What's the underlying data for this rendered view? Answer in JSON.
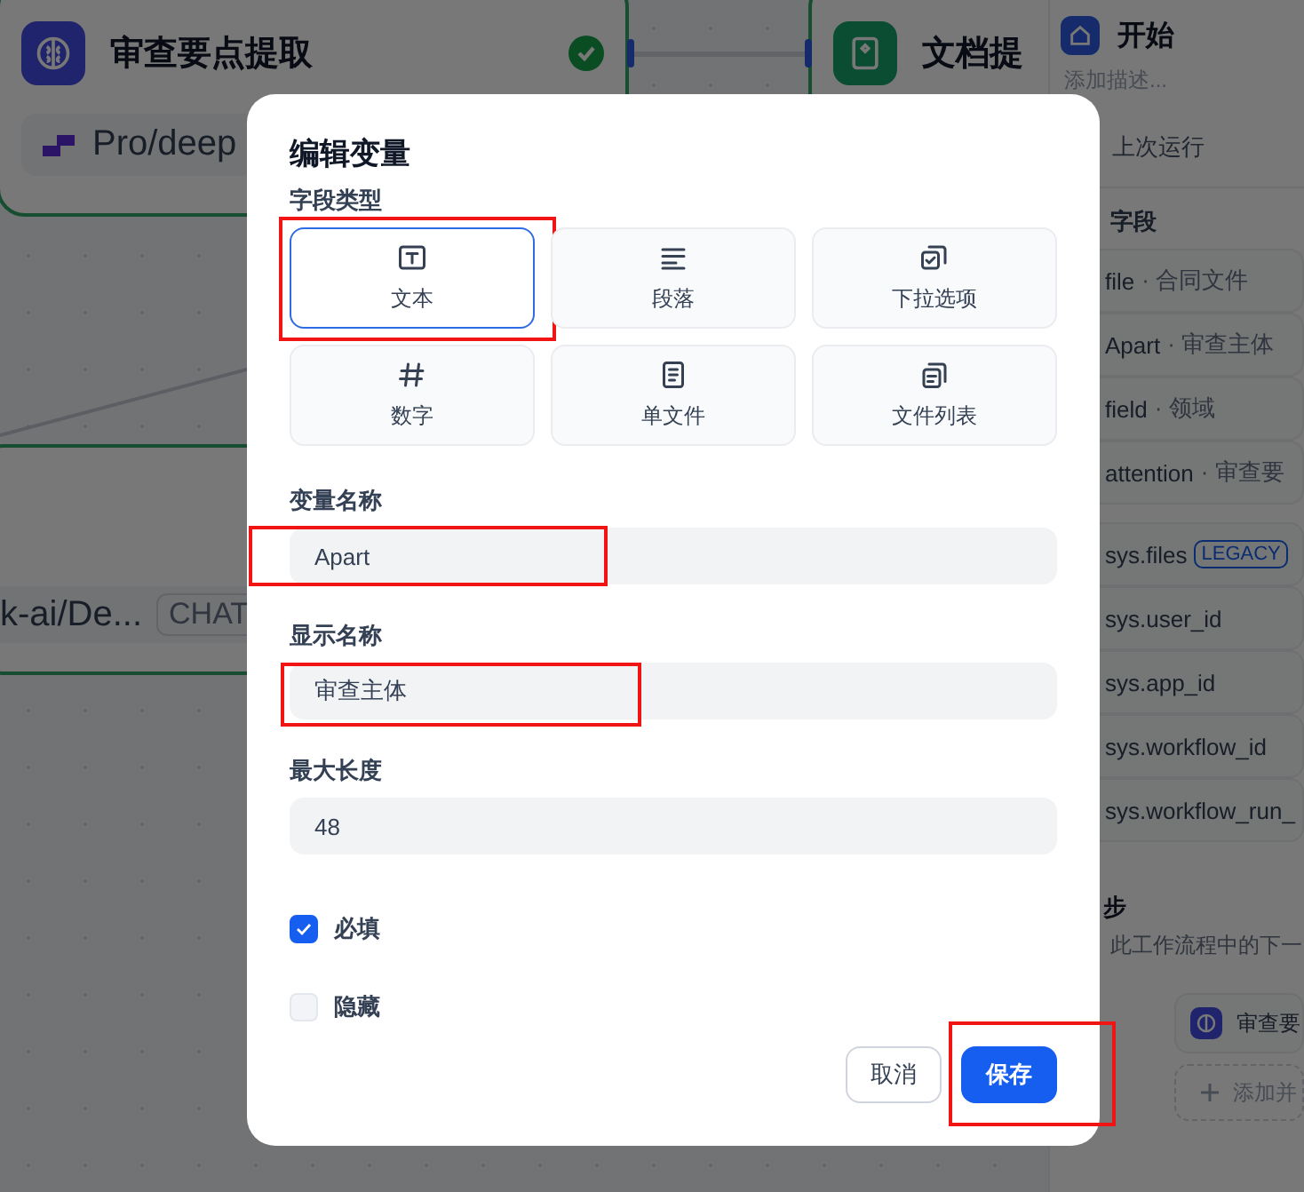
{
  "canvas": {
    "nodes": [
      {
        "title": "审查要点提取",
        "kind": "llm",
        "done": true,
        "model": "Pro/deep"
      },
      {
        "title": "文档提",
        "kind": "doc"
      }
    ],
    "lower_model": {
      "name": "k-ai/De...",
      "badge": "CHAT"
    }
  },
  "side_panel": {
    "title": "开始",
    "description_placeholder": "添加描述...",
    "last_run_tab": "上次运行",
    "section": "字段",
    "variables": [
      {
        "name": "file",
        "label": "· 合同文件"
      },
      {
        "name": "Apart",
        "label": "· 审查主体"
      },
      {
        "name": "field",
        "label": "· 领域"
      },
      {
        "name": "attention",
        "label": "· 审查要"
      }
    ],
    "system_variables": [
      {
        "name": "sys.files",
        "badge": "LEGACY"
      },
      {
        "name": "sys.user_id"
      },
      {
        "name": "sys.app_id"
      },
      {
        "name": "sys.workflow_id"
      },
      {
        "name": "sys.workflow_run_"
      }
    ],
    "next_step": {
      "title": "步",
      "description": "此工作流程中的下一",
      "node": "审查要",
      "add_parallel": "添加并"
    }
  },
  "dialog": {
    "title": "编辑变量",
    "field_type_label": "字段类型",
    "field_types": [
      {
        "label": "文本",
        "kind": "text",
        "selected": true,
        "highlighted": true
      },
      {
        "label": "段落",
        "kind": "paragraph",
        "selected": false,
        "highlighted": false
      },
      {
        "label": "下拉选项",
        "kind": "select",
        "selected": false,
        "highlighted": false
      },
      {
        "label": "数字",
        "kind": "number",
        "selected": false,
        "highlighted": false
      },
      {
        "label": "单文件",
        "kind": "file",
        "selected": false,
        "highlighted": false
      },
      {
        "label": "文件列表",
        "kind": "files",
        "selected": false,
        "highlighted": false
      }
    ],
    "fields": [
      {
        "label": "变量名称",
        "value": "Apart",
        "highlighted": true
      },
      {
        "label": "显示名称",
        "value": "审查主体",
        "highlighted": true
      },
      {
        "label": "最大长度",
        "value": "48"
      }
    ],
    "options": [
      {
        "label": "必填",
        "checked": true
      },
      {
        "label": "隐藏",
        "checked": false
      }
    ],
    "buttons": [
      {
        "label": "取消",
        "kind": "secondary"
      },
      {
        "label": "保存",
        "kind": "primary",
        "highlighted": true
      }
    ]
  }
}
